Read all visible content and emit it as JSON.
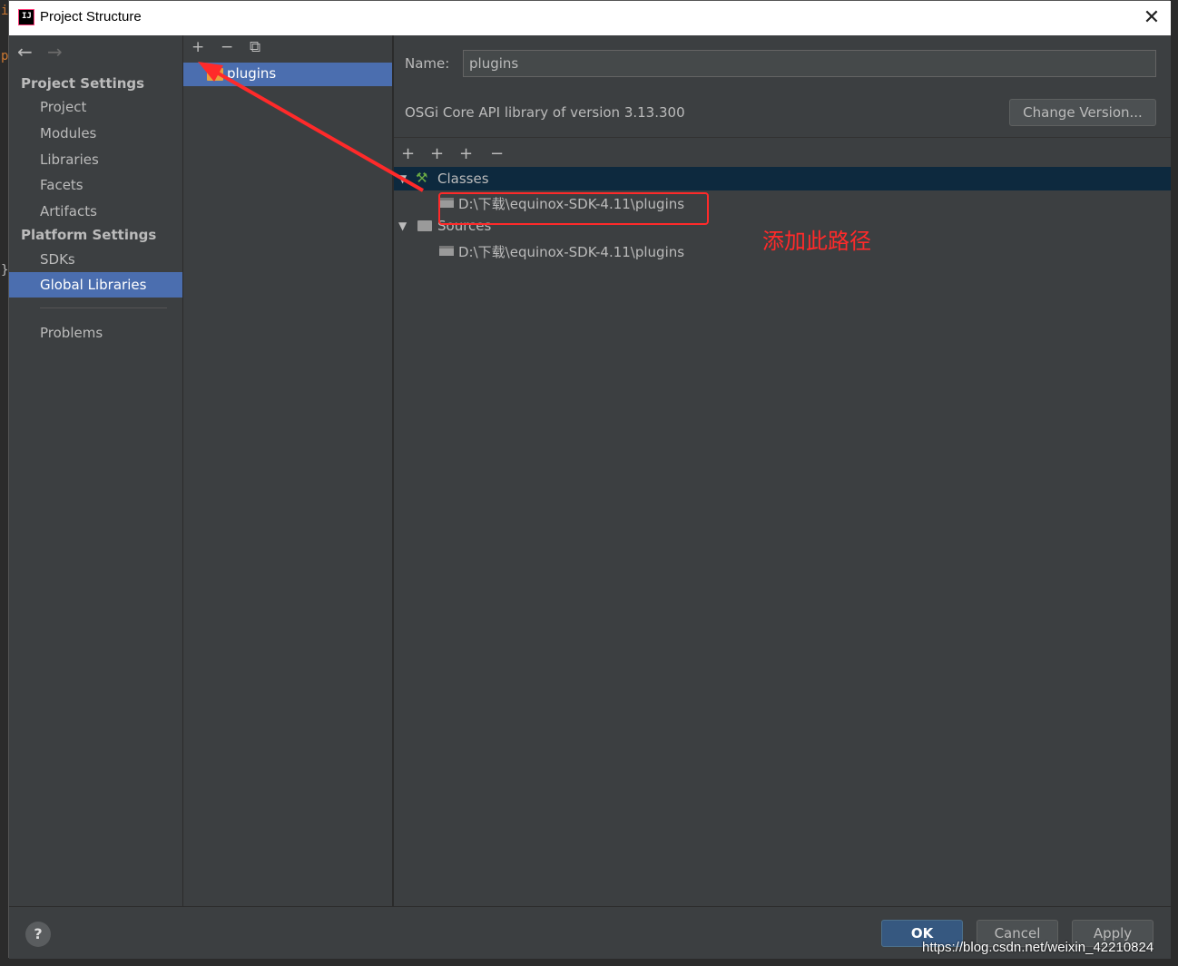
{
  "background": {
    "glyphs": [
      "i",
      "p",
      "}"
    ]
  },
  "window": {
    "title": "Project Structure",
    "close_icon": "close-icon",
    "app_icon_label": "IJ"
  },
  "nav": {
    "back_icon": "←",
    "forward_icon": "→",
    "project_settings_heading": "Project Settings",
    "project_items": [
      "Project",
      "Modules",
      "Libraries",
      "Facets",
      "Artifacts"
    ],
    "platform_settings_heading": "Platform Settings",
    "platform_items": [
      "SDKs",
      "Global Libraries"
    ],
    "selected": "Global Libraries",
    "problems": "Problems"
  },
  "library_list": {
    "add_icon": "+",
    "remove_icon": "−",
    "copy_icon": "⧉",
    "items": [
      "plugins"
    ]
  },
  "details": {
    "name_label": "Name:",
    "name_value": "plugins",
    "description": "OSGi Core API library of version 3.13.300",
    "change_version_label": "Change Version...",
    "tree_tools": [
      "+",
      "+",
      "+",
      "−"
    ],
    "classes_label": "Classes",
    "classes_path": "D:\\下载\\equinox-SDK-4.11\\plugins",
    "sources_label": "Sources",
    "sources_path": "D:\\下载\\equinox-SDK-4.11\\plugins"
  },
  "footer": {
    "help_label": "?",
    "ok_label": "OK",
    "cancel_label": "Cancel",
    "apply_label": "Apply"
  },
  "annotation": {
    "text": "添加此路径",
    "color": "#ff2a2a"
  },
  "watermark": "https://blog.csdn.net/weixin_42210824",
  "colors": {
    "selection": "#4b6eaf",
    "panel": "#3c3f41",
    "tree_selection": "#0d293e",
    "ok_button": "#365880"
  }
}
